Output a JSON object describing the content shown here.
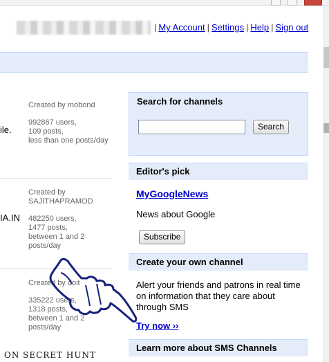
{
  "header": {
    "nav": [
      {
        "label": "My Account"
      },
      {
        "label": "Settings"
      },
      {
        "label": "Help"
      },
      {
        "label": "Sign out"
      }
    ],
    "separator": "|"
  },
  "channels": [
    {
      "name_fragment": "ile.",
      "creator": "Created by mobond",
      "users": "992867 users,",
      "posts": "109 posts,",
      "frequency": "less than one posts/day"
    },
    {
      "name_fragment": "IA.IN",
      "creator_prefix": "Created by",
      "creator_name": "SAJITHAPRAMOD",
      "users": "482250 users,",
      "posts": "1477 posts,",
      "frequency_1": "between 1 and 2",
      "frequency_2": "posts/day"
    },
    {
      "creator": "Created by doit",
      "users": "335222 users,",
      "posts": "1318 posts,",
      "frequency_1": "between 1 and 2",
      "frequency_2": "posts/day"
    }
  ],
  "sidebar": {
    "search": {
      "heading": "Search for channels",
      "input_value": "",
      "button_label": "Search"
    },
    "editors_pick": {
      "heading": "Editor's pick",
      "channel_name": "MyGoogleNews",
      "description": "News about Google",
      "subscribe_label": "Subscribe"
    },
    "create": {
      "heading": "Create your own channel",
      "description": "Alert your friends and patrons in real time on information that they care about through SMS",
      "try_label": "Try now ››"
    },
    "learn_more": {
      "heading": "Learn more about SMS Channels"
    }
  },
  "watermark": "ON SECRET HUNT",
  "icons": {
    "pointer": "pointing-hand-icon"
  }
}
